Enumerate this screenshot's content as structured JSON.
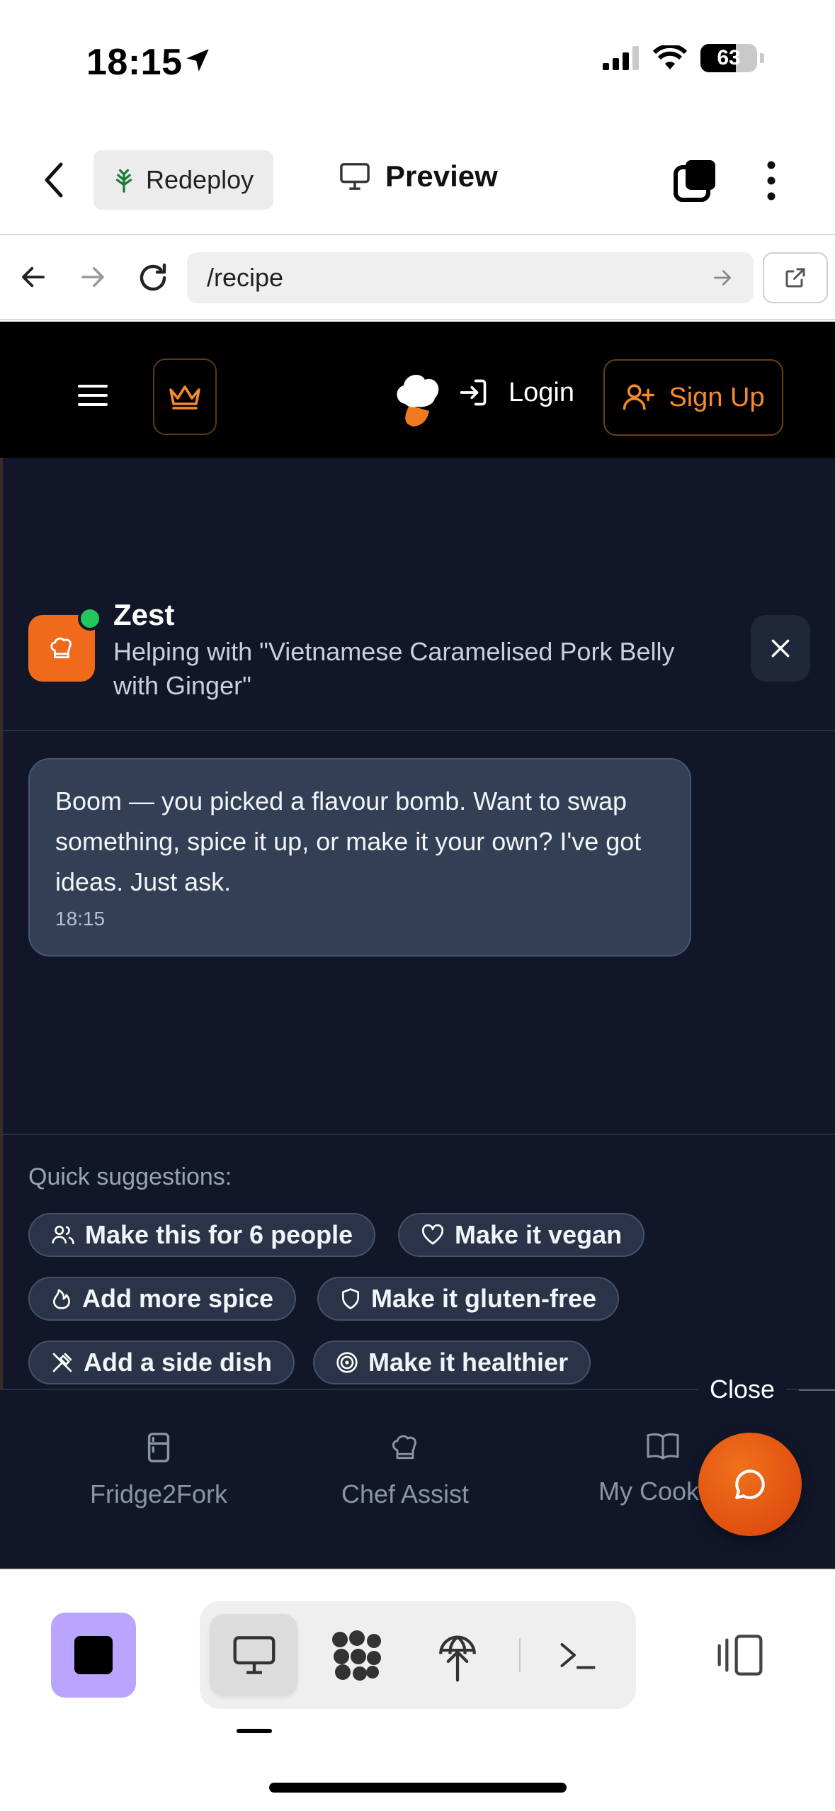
{
  "status_bar": {
    "time": "18:15",
    "battery": "63"
  },
  "app_bar": {
    "redeploy_label": "Redeploy",
    "preview_label": "Preview"
  },
  "url_bar": {
    "path": "/recipe"
  },
  "site_nav": {
    "login_label": "Login",
    "signup_label": "Sign Up"
  },
  "chat": {
    "assistant_name": "Zest",
    "helping_text": "Helping with \"Vietnamese Caramelised Pork Belly with Ginger\"",
    "message": {
      "text": "Boom — you picked a flavour bomb. Want to swap something, spice it up, or make it your own? I've got ideas. Just ask.",
      "time": "18:15"
    },
    "quick_suggestions_label": "Quick suggestions:",
    "suggestions": [
      {
        "label": "Make this for 6 people",
        "icon": "people-icon"
      },
      {
        "label": "Make it vegan",
        "icon": "heart-icon"
      },
      {
        "label": "Add more spice",
        "icon": "flame-icon"
      },
      {
        "label": "Make it gluten-free",
        "icon": "shield-icon"
      },
      {
        "label": "Add a side dish",
        "icon": "utensils-icon"
      },
      {
        "label": "Make it healthier",
        "icon": "target-icon"
      }
    ],
    "close_label": "Close"
  },
  "bottom_nav": {
    "items": [
      {
        "label": "Fridge2Fork",
        "icon": "fridge-icon"
      },
      {
        "label": "Chef Assist",
        "icon": "chef-hat-icon"
      },
      {
        "label": "My Cookbo",
        "icon": "book-icon"
      }
    ]
  },
  "colors": {
    "accent": "#f58a2a",
    "panel_bg": "#111729",
    "stop_button": "#b9a4ff",
    "online": "#22c55e"
  }
}
